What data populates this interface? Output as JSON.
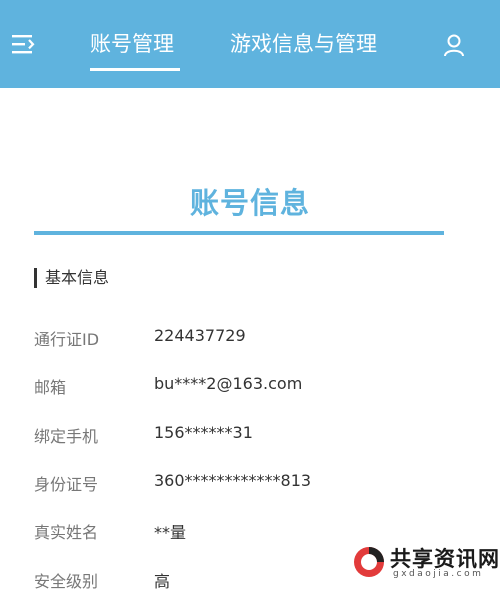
{
  "header": {
    "menu_icon": "menu-icon",
    "tabs": [
      {
        "label": "账号管理",
        "active": true
      },
      {
        "label": "游戏信息与管理",
        "active": false
      }
    ],
    "user_icon": "user-icon",
    "background_color": "#5fb3de"
  },
  "main": {
    "title": "账号信息",
    "section_title": "基本信息",
    "fields": [
      {
        "label": "通行证ID",
        "value": "224437729"
      },
      {
        "label": "邮箱",
        "value": "bu****2@163.com"
      },
      {
        "label": "绑定手机",
        "value": "156******31"
      },
      {
        "label": "身份证号",
        "value": "360************813"
      },
      {
        "label": "真实姓名",
        "value": "**量"
      },
      {
        "label": "安全级别",
        "value": "高"
      }
    ]
  },
  "watermark": {
    "name": "共享资讯网",
    "domain": "gxdaojia.com"
  }
}
